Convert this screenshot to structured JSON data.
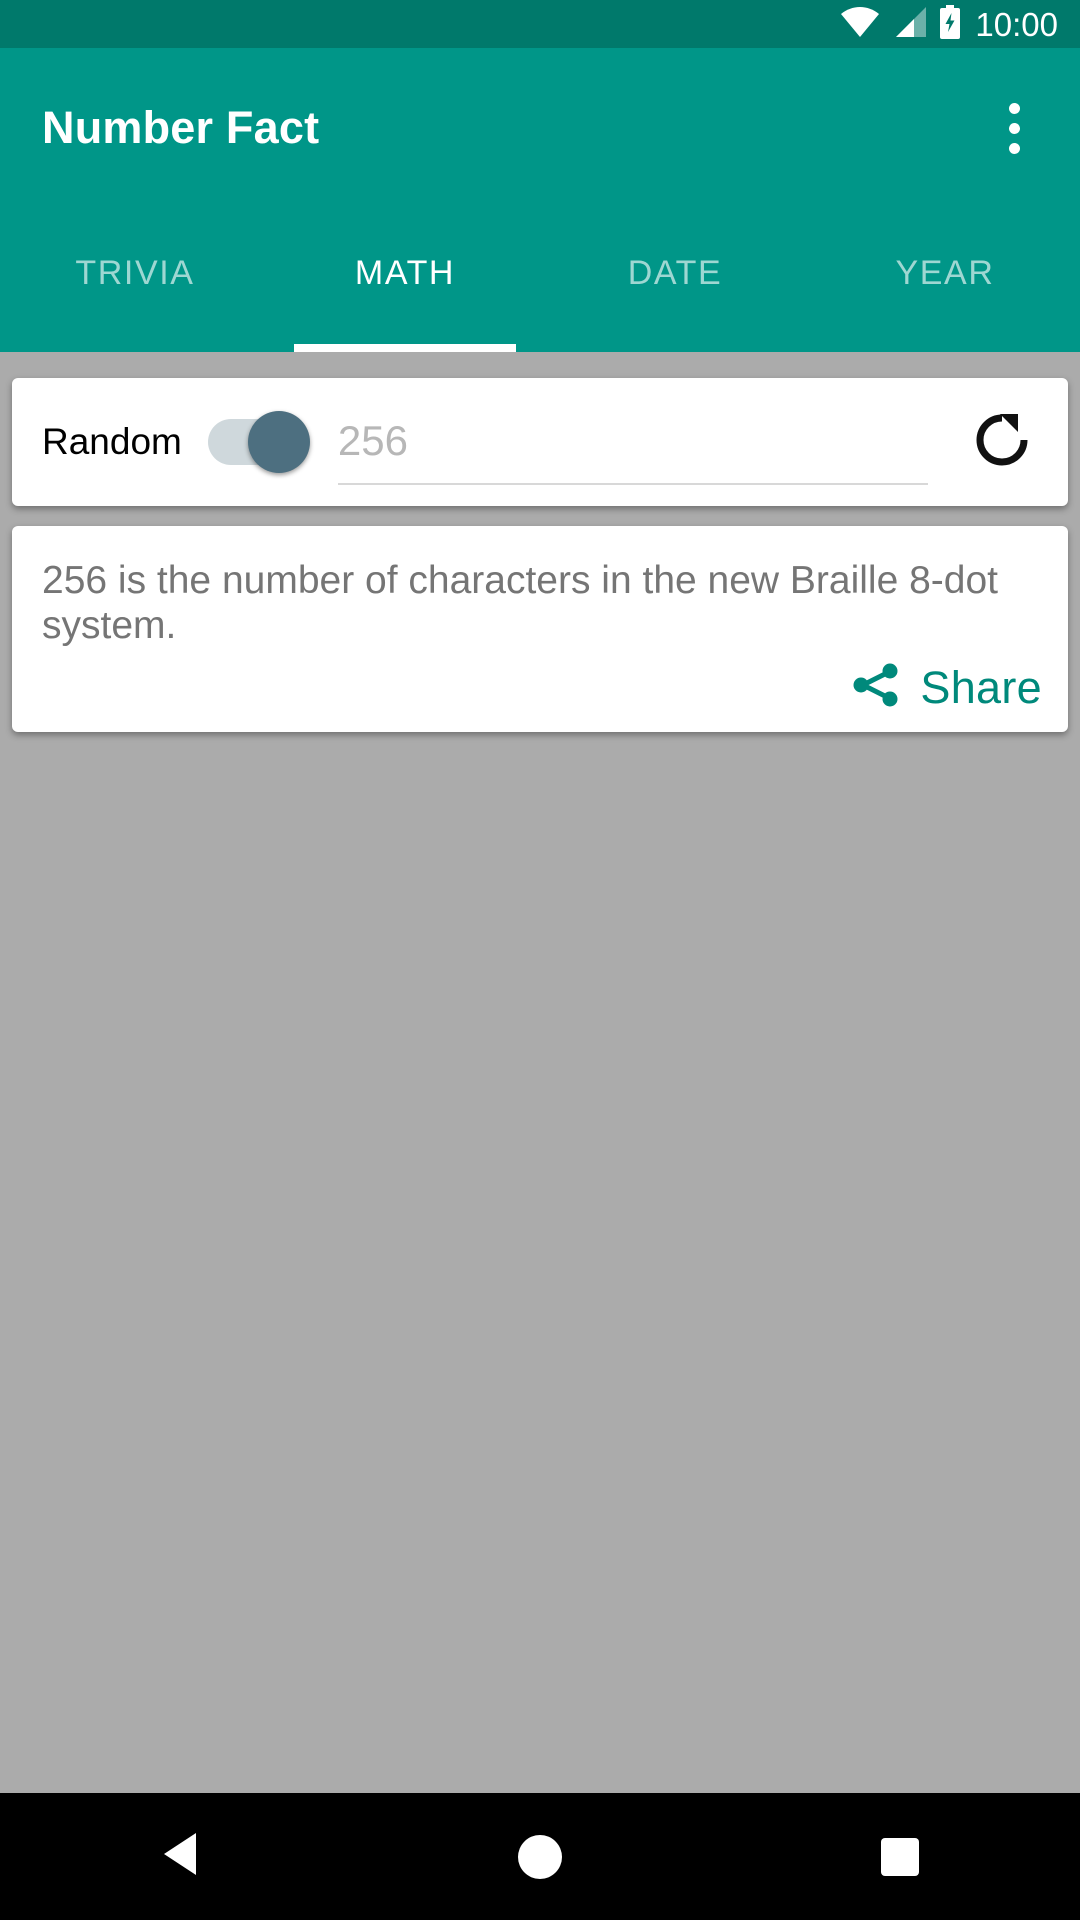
{
  "status_bar": {
    "time": "10:00",
    "icons": [
      "wifi-icon",
      "cellular-signal-icon",
      "battery-charging-icon"
    ],
    "background_color": "#00796B"
  },
  "app_bar": {
    "title": "Number Fact",
    "overflow_menu_label": "More options",
    "background_color": "#009688"
  },
  "tabs": [
    {
      "label": "TRIVIA",
      "active": false
    },
    {
      "label": "MATH",
      "active": true
    },
    {
      "label": "DATE",
      "active": false
    },
    {
      "label": "YEAR",
      "active": false
    }
  ],
  "input_card": {
    "random_label": "Random",
    "random_toggle_state": "on",
    "number_value": "256",
    "number_placeholder": "256",
    "refresh_label": "Refresh"
  },
  "fact_card": {
    "fact_text": "256 is the number of characters in the new Braille 8-dot system.",
    "share_label": "Share",
    "share_color": "#00897B"
  },
  "nav_bar": {
    "back_label": "Back",
    "home_label": "Home",
    "recents_label": "Recents"
  },
  "colors": {
    "primary": "#009688",
    "primary_dark": "#00796B",
    "accent": "#00897B",
    "background": "#ABABAB",
    "card": "#FFFFFF",
    "fact_text": "#757575",
    "placeholder": "#B7B7B7",
    "toggle_thumb": "#4D6F80",
    "toggle_track": "#CFD8DC"
  }
}
